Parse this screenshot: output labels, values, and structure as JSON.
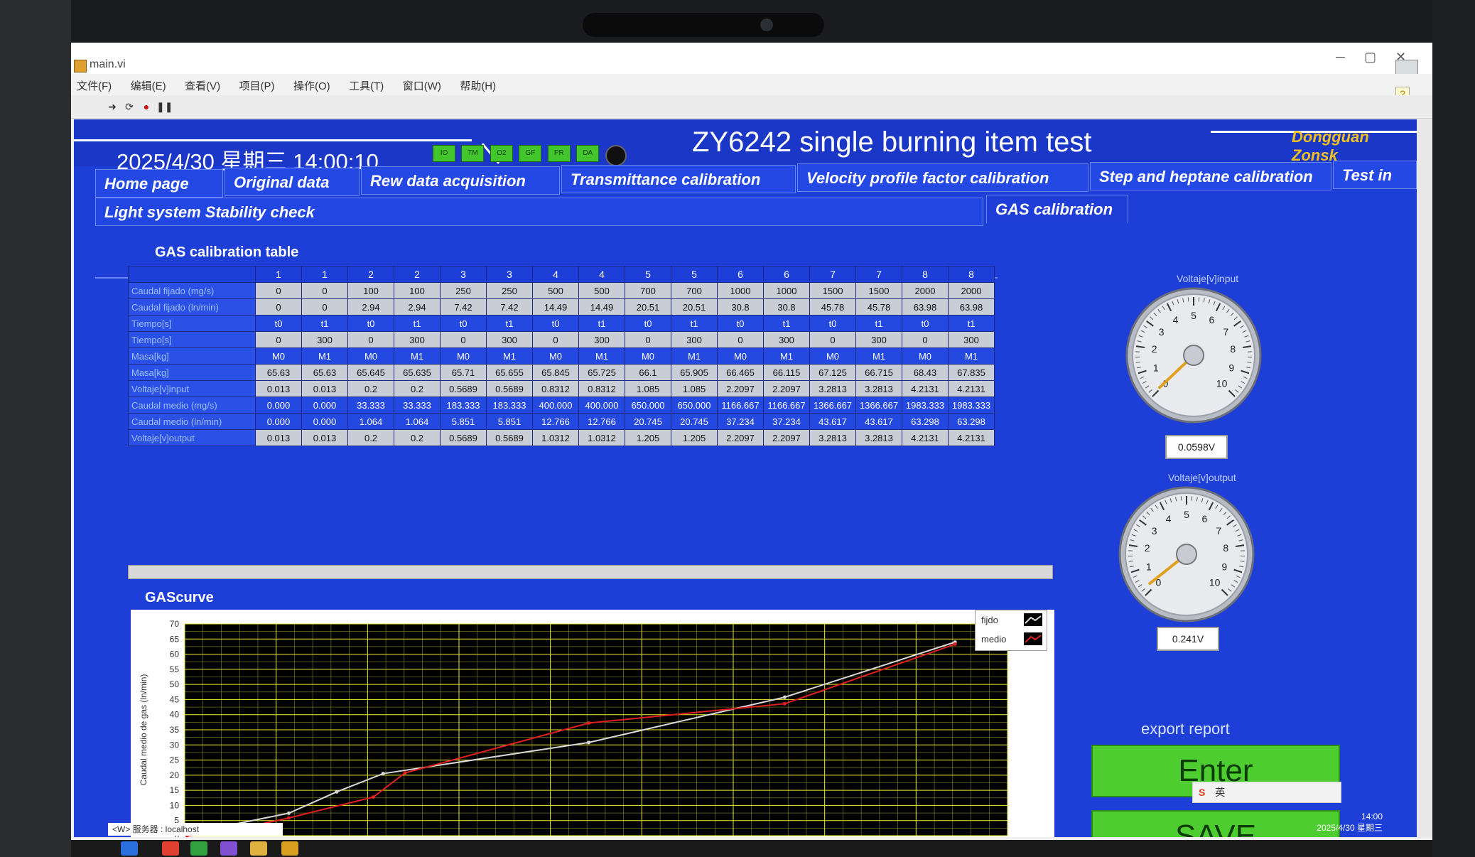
{
  "window": {
    "title": "main.vi"
  },
  "menu": [
    "文件(F)",
    "编辑(E)",
    "查看(V)",
    "项目(P)",
    "操作(O)",
    "工具(T)",
    "窗口(W)",
    "帮助(H)"
  ],
  "header": {
    "datetime": "2025/4/30 星期三   14:00:10",
    "leds": [
      "IO",
      "TM",
      "O2",
      "GF",
      "PR",
      "DA"
    ],
    "title": "ZY6242 single burning item test",
    "company": "Dongguan Zonsk"
  },
  "tabs_row1": [
    "Home page",
    "Original data",
    "Rew data acquisition",
    "Transmittance calibration",
    "Velocity profile factor calibration",
    "Step and heptane calibration",
    "Test in"
  ],
  "tabs_row2": [
    "Light system Stability check",
    "GAS calibration"
  ],
  "table": {
    "title": "GAS calibration table",
    "column_headers": [
      "1",
      "1",
      "2",
      "2",
      "3",
      "3",
      "4",
      "4",
      "5",
      "5",
      "6",
      "6",
      "7",
      "7",
      "8",
      "8"
    ],
    "rows": [
      {
        "label": "Caudal fijado (mg/s)",
        "style": "gray",
        "cells": [
          "0",
          "0",
          "100",
          "100",
          "250",
          "250",
          "500",
          "500",
          "700",
          "700",
          "1000",
          "1000",
          "1500",
          "1500",
          "2000",
          "2000"
        ]
      },
      {
        "label": "Caudal fijado (ln/min)",
        "style": "gray",
        "cells": [
          "0",
          "0",
          "2.94",
          "2.94",
          "7.42",
          "7.42",
          "14.49",
          "14.49",
          "20.51",
          "20.51",
          "30.8",
          "30.8",
          "45.78",
          "45.78",
          "63.98",
          "63.98"
        ]
      },
      {
        "label": "Tiempo[s]",
        "style": "blue",
        "cells": [
          "t0",
          "t1",
          "t0",
          "t1",
          "t0",
          "t1",
          "t0",
          "t1",
          "t0",
          "t1",
          "t0",
          "t1",
          "t0",
          "t1",
          "t0",
          "t1"
        ]
      },
      {
        "label": "Tiempo[s]",
        "style": "gray",
        "cells": [
          "0",
          "300",
          "0",
          "300",
          "0",
          "300",
          "0",
          "300",
          "0",
          "300",
          "0",
          "300",
          "0",
          "300",
          "0",
          "300"
        ]
      },
      {
        "label": "Masa[kg]",
        "style": "blue",
        "cells": [
          "M0",
          "M1",
          "M0",
          "M1",
          "M0",
          "M1",
          "M0",
          "M1",
          "M0",
          "M1",
          "M0",
          "M1",
          "M0",
          "M1",
          "M0",
          "M1"
        ]
      },
      {
        "label": "Masa[kg]",
        "style": "gray",
        "cells": [
          "65.63",
          "65.63",
          "65.645",
          "65.635",
          "65.71",
          "65.655",
          "65.845",
          "65.725",
          "66.1",
          "65.905",
          "66.465",
          "66.115",
          "67.125",
          "66.715",
          "68.43",
          "67.835"
        ]
      },
      {
        "label": "Voltaje[v]input",
        "style": "gray",
        "cells": [
          "0.013",
          "0.013",
          "0.2",
          "0.2",
          "0.5689",
          "0.5689",
          "0.8312",
          "0.8312",
          "1.085",
          "1.085",
          "2.2097",
          "2.2097",
          "3.2813",
          "3.2813",
          "4.2131",
          "4.2131"
        ]
      },
      {
        "label": "Caudal medio (mg/s)",
        "style": "blue",
        "cells": [
          "0.000",
          "0.000",
          "33.333",
          "33.333",
          "183.333",
          "183.333",
          "400.000",
          "400.000",
          "650.000",
          "650.000",
          "1166.667",
          "1166.667",
          "1366.667",
          "1366.667",
          "1983.333",
          "1983.333"
        ]
      },
      {
        "label": "Caudal medio (ln/min)",
        "style": "blue",
        "cells": [
          "0.000",
          "0.000",
          "1.064",
          "1.064",
          "5.851",
          "5.851",
          "12.766",
          "12.766",
          "20.745",
          "20.745",
          "37.234",
          "37.234",
          "43.617",
          "43.617",
          "63.298",
          "63.298"
        ]
      },
      {
        "label": "Voltaje[v]output",
        "style": "gray",
        "cells": [
          "0.013",
          "0.013",
          "0.2",
          "0.2",
          "0.5689",
          "0.5689",
          "1.0312",
          "1.0312",
          "1.205",
          "1.205",
          "2.2097",
          "2.2097",
          "3.2813",
          "3.2813",
          "4.2131",
          "4.2131"
        ]
      }
    ]
  },
  "chart_data": {
    "type": "line",
    "title": "GAScurve",
    "xlabel": "",
    "ylabel": "Caudal medio de gas (ln/min)",
    "xlim": [
      0,
      4.5
    ],
    "ylim": [
      0,
      70
    ],
    "xticks": [
      "0",
      "0.5",
      "1",
      "1.5",
      "2",
      "2.5",
      "3",
      "3.5",
      "4",
      "4.5"
    ],
    "yticks": [
      "0",
      "5",
      "10",
      "15",
      "20",
      "25",
      "30",
      "35",
      "40",
      "45",
      "50",
      "55",
      "60",
      "65",
      "70"
    ],
    "grid": true,
    "background": "#000000",
    "legend_position": "top-right",
    "series": [
      {
        "name": "fijdo",
        "color": "#d8d8d8",
        "x": [
          0.013,
          0.2,
          0.5689,
          0.8312,
          1.085,
          2.2097,
          3.2813,
          4.2131
        ],
        "y": [
          0,
          2.94,
          7.42,
          14.49,
          20.51,
          30.8,
          45.78,
          63.98
        ]
      },
      {
        "name": "medio",
        "color": "#e02020",
        "x": [
          0.013,
          0.2,
          0.5689,
          1.0312,
          1.205,
          2.2097,
          3.2813,
          4.2131
        ],
        "y": [
          0,
          1.064,
          5.851,
          12.766,
          20.745,
          37.234,
          43.617,
          63.298
        ]
      }
    ]
  },
  "gauges": [
    {
      "label": "Voltaje[v]input",
      "value": "0.0598V",
      "scale": [
        "0",
        "1",
        "2",
        "3",
        "4",
        "5",
        "6",
        "7",
        "8",
        "9",
        "10"
      ],
      "reading": 0.0598
    },
    {
      "label": "Voltaje[v]output",
      "value": "0.241V",
      "scale": [
        "0",
        "1",
        "2",
        "3",
        "4",
        "5",
        "6",
        "7",
        "8",
        "9",
        "10"
      ],
      "reading": 0.241
    }
  ],
  "actions": {
    "export_label": "export report",
    "enter_label": "Enter",
    "save_label": "SAVE"
  },
  "status": {
    "strip_text": "<W> 服务器 : localhost",
    "ime_label": "英",
    "clock_time": "14:00",
    "clock_date": "2025/4/30 星期三"
  }
}
